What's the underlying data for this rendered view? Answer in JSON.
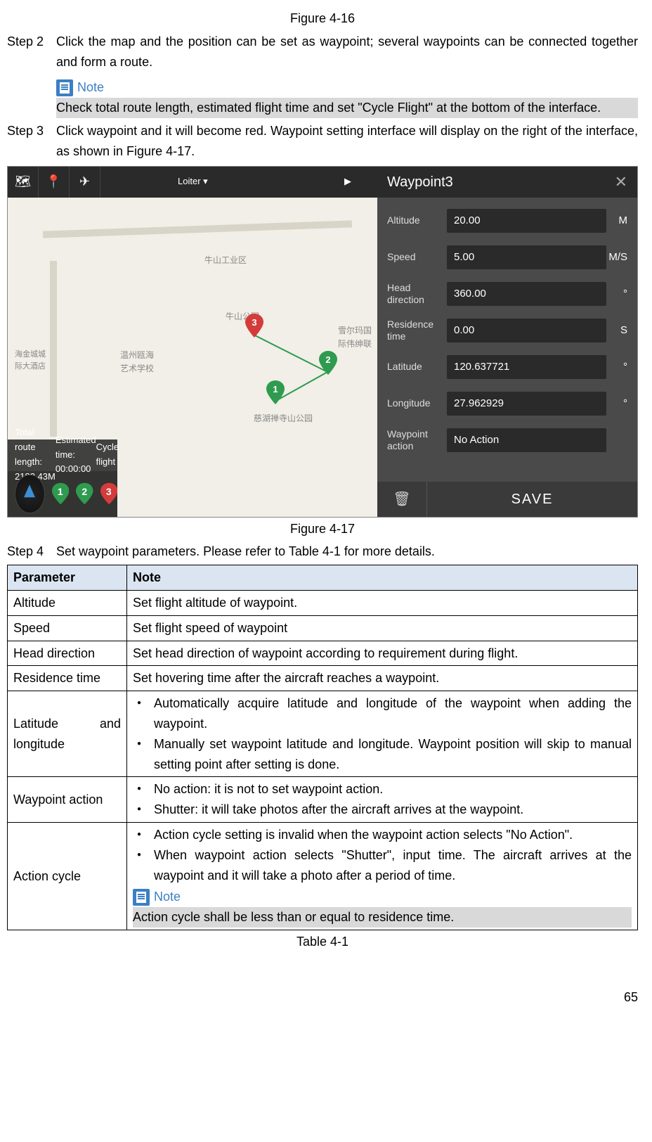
{
  "figure_top": "Figure 4-16",
  "step2": {
    "label": "Step 2",
    "text": "Click the map and the position can be set as waypoint; several waypoints can be connected together and form a route.",
    "note_label": "Note",
    "note_text": "Check total route length, estimated flight time and set \"Cycle Flight\" at the bottom of the interface."
  },
  "step3": {
    "label": "Step 3",
    "text": "Click waypoint and it will become red. Waypoint setting interface will display on the right of the interface, as shown in Figure 4-17."
  },
  "screenshot": {
    "loiter": "Loiter",
    "panel_title": "Waypoint3",
    "params": [
      {
        "label": "Altitude",
        "value": "20.00",
        "unit": "M"
      },
      {
        "label": "Speed",
        "value": "5.00",
        "unit": "M/S"
      },
      {
        "label": "Head direction",
        "value": "360.00",
        "unit": "°"
      },
      {
        "label": "Residence time",
        "value": "0.00",
        "unit": "S"
      },
      {
        "label": "Latitude",
        "value": "120.637721",
        "unit": "°"
      },
      {
        "label": "Longitude",
        "value": "27.962929",
        "unit": "°"
      },
      {
        "label": "Waypoint action",
        "value": "No Action",
        "unit": ""
      }
    ],
    "save": "SAVE",
    "footer": {
      "route_length": "Total route length: 2183.43M",
      "est_time": "Estimated time: 00:00:00",
      "cycle": "Cycle flight"
    },
    "map_labels": {
      "l1": "牛山工业区",
      "l2": "牛山公园",
      "l3": "慈湖禅寺山公园",
      "l4": "温州瓯海\n艺术学校",
      "l5": "雪尔玛国\n际伟绅联",
      "l6": "海金城城\n际大酒店"
    },
    "pins": {
      "p1": "1",
      "p2": "2",
      "p3": "3"
    }
  },
  "figure_mid": "Figure 4-17",
  "step4": {
    "label": "Step 4",
    "text": "Set waypoint parameters. Please refer to Table 4-1 for more details."
  },
  "table": {
    "header": {
      "c1": "Parameter",
      "c2": "Note"
    },
    "rows": {
      "altitude": {
        "p": "Altitude",
        "n": "Set flight altitude of waypoint."
      },
      "speed": {
        "p": "Speed",
        "n": "Set flight speed of waypoint"
      },
      "head": {
        "p": "Head direction",
        "n": "Set head direction of waypoint according to requirement during flight."
      },
      "residence": {
        "p": "Residence time",
        "n": "Set hovering time after the aircraft reaches a waypoint."
      },
      "latlon": {
        "p": "Latitude and longitude",
        "b1": "Automatically acquire latitude and longitude of the waypoint when adding the waypoint.",
        "b2": "Manually set waypoint latitude and longitude. Waypoint position will skip to manual setting point after setting is done."
      },
      "wpaction": {
        "p": "Waypoint action",
        "b1": "No action: it is not to set waypoint action.",
        "b2": "Shutter: it will take photos after the aircraft arrives at the waypoint."
      },
      "actioncycle": {
        "p": "Action cycle",
        "b1": "Action cycle setting is invalid when the waypoint action selects \"No Action\".",
        "b2": "When waypoint action selects \"Shutter\", input time. The aircraft arrives at the waypoint and it will take a photo after a period of time.",
        "note_label": "Note",
        "note_text": "Action cycle shall be less than or equal to residence time."
      }
    }
  },
  "table_caption": "Table 4-1",
  "page_number": "65"
}
